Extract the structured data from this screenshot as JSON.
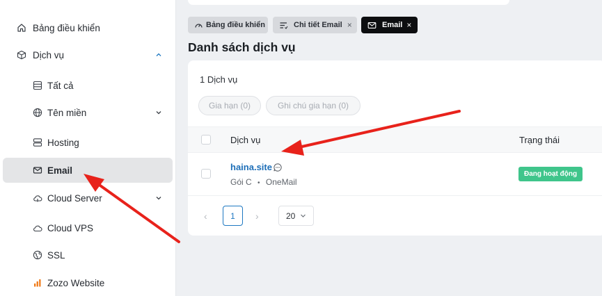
{
  "sidebar": {
    "items": [
      {
        "label": "Bảng điều khiển",
        "icon": "home-icon"
      },
      {
        "label": "Dịch vụ",
        "icon": "box-icon",
        "expanded": true
      },
      {
        "label": "Tất cả",
        "icon": "database-icon"
      },
      {
        "label": "Tên miền",
        "icon": "globe-icon"
      },
      {
        "label": "Hosting",
        "icon": "server-icon"
      },
      {
        "label": "Email",
        "icon": "mail-icon",
        "active": true
      },
      {
        "label": "Cloud Server",
        "icon": "cloud-icon"
      },
      {
        "label": "Cloud VPS",
        "icon": "cloud-icon"
      },
      {
        "label": "SSL",
        "icon": "ssl-globe-icon"
      },
      {
        "label": "Zozo Website",
        "icon": "zozo-logo-icon"
      }
    ]
  },
  "tabs": [
    {
      "label": "Bảng điều khiển",
      "icon": "speedometer-icon",
      "closable": false
    },
    {
      "label": "Chi tiết Email",
      "icon": "list-icon",
      "closable": true
    },
    {
      "label": "Email",
      "icon": "mail-icon",
      "closable": true,
      "active": true
    }
  ],
  "tab_close": "×",
  "page": {
    "title": "Danh sách dịch vụ"
  },
  "summary": {
    "count_text": "1 Dịch vụ"
  },
  "actions": {
    "renew": "Gia hạn (0)",
    "renew_note": "Ghi chú gia hạn (0)"
  },
  "table": {
    "columns": [
      "Dịch vụ",
      "Trạng thái"
    ],
    "rows": [
      {
        "name": "haina.site",
        "plan": "Gói C",
        "separator": "•",
        "provider": "OneMail",
        "status": "Đang hoạt động"
      }
    ]
  },
  "pagination": {
    "prev": "‹",
    "current": "1",
    "next": "›",
    "page_size": "20"
  },
  "colors": {
    "accent": "#1e78c2",
    "status_active": "#3fc58b",
    "annotation_arrow": "#e8221b"
  }
}
